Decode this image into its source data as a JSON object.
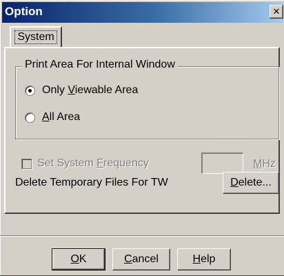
{
  "window": {
    "title": "Option",
    "close_glyph": "✕"
  },
  "tabs": [
    {
      "label": "System"
    }
  ],
  "print_area": {
    "legend": "Print Area For Internal Window",
    "options": [
      {
        "prefix": "Only ",
        "mnemonic": "V",
        "rest": "iewable Area",
        "selected": true
      },
      {
        "prefix": "",
        "mnemonic": "A",
        "rest": "ll Area",
        "selected": false
      }
    ]
  },
  "frequency": {
    "checkbox_prefix": "Set System ",
    "checkbox_mnemonic": "F",
    "checkbox_rest": "requency",
    "checked": false,
    "enabled": false,
    "value": "",
    "unit_mnemonic": "M",
    "unit_rest": "Hz"
  },
  "temp_files": {
    "label": "Delete Temporary Files For TW",
    "button_mnemonic": "D",
    "button_rest": "elete..."
  },
  "buttons": {
    "ok_mnemonic": "O",
    "ok_rest": "K",
    "cancel_mnemonic": "C",
    "cancel_rest": "ancel",
    "help_mnemonic": "H",
    "help_rest": "elp"
  },
  "colors": {
    "face": "#d4d0c8",
    "title_start": "#0a246a",
    "title_end": "#a6caf0",
    "disabled_text": "#808080"
  }
}
